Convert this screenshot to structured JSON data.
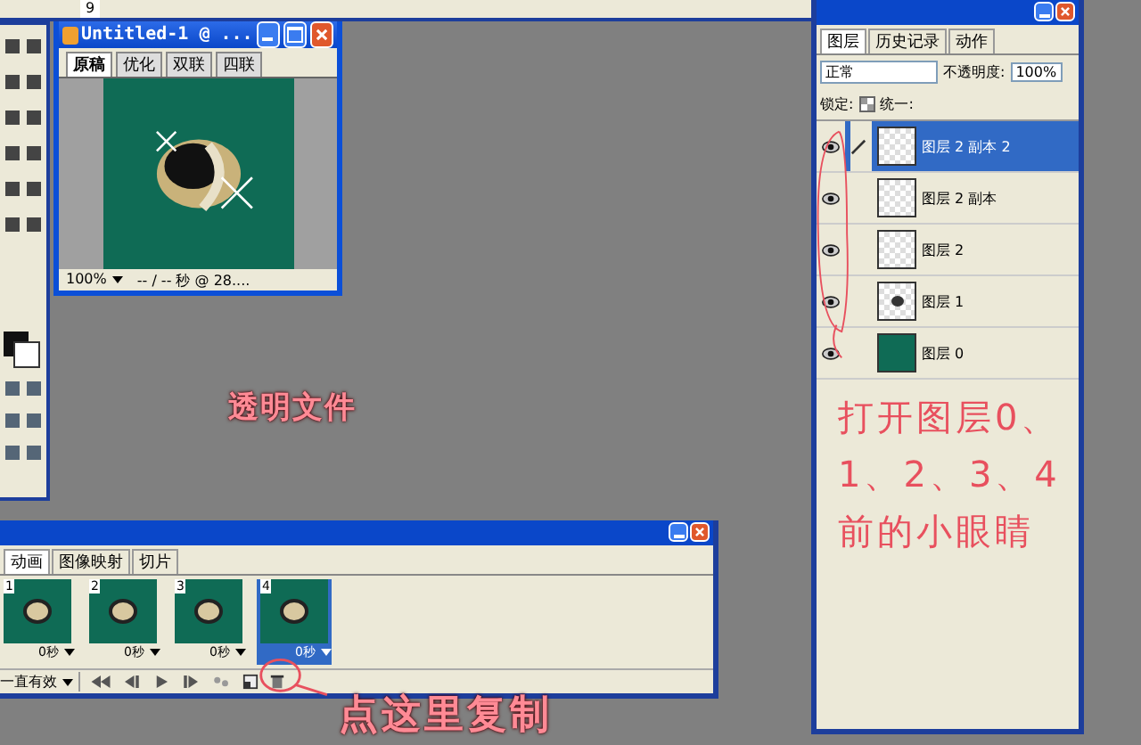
{
  "options_bar": {
    "value": "9"
  },
  "document_window": {
    "title": "Untitled-1 @ ...",
    "tabs": [
      {
        "label": "原稿",
        "selected": true
      },
      {
        "label": "优化",
        "selected": false
      },
      {
        "label": "双联",
        "selected": false
      },
      {
        "label": "四联",
        "selected": false
      }
    ],
    "zoom": "100%",
    "status": "-- / -- 秒 @ 28...."
  },
  "canvas_label": "透明文件",
  "layers_panel": {
    "tabs": [
      {
        "label": "图层",
        "selected": true
      },
      {
        "label": "历史记录",
        "selected": false
      },
      {
        "label": "动作",
        "selected": false
      }
    ],
    "blend_mode": "正常",
    "opacity_label": "不透明度:",
    "opacity": "100%",
    "lock_label": "锁定:",
    "unify_label": "统一:",
    "layers": [
      {
        "name": "图层 2 副本 2",
        "selected": true,
        "visible": true,
        "kind": "transparent"
      },
      {
        "name": "图层 2 副本",
        "selected": false,
        "visible": true,
        "kind": "transparent"
      },
      {
        "name": "图层 2",
        "selected": false,
        "visible": true,
        "kind": "transparent"
      },
      {
        "name": "图层 1",
        "selected": false,
        "visible": true,
        "kind": "object"
      },
      {
        "name": "图层 0",
        "selected": false,
        "visible": true,
        "kind": "fill"
      }
    ]
  },
  "animation_panel": {
    "tabs": [
      {
        "label": "动画",
        "selected": true
      },
      {
        "label": "图像映射",
        "selected": false
      },
      {
        "label": "切片",
        "selected": false
      }
    ],
    "frames": [
      {
        "number": "1",
        "delay": "0秒",
        "selected": false
      },
      {
        "number": "2",
        "delay": "0秒",
        "selected": false
      },
      {
        "number": "3",
        "delay": "0秒",
        "selected": false
      },
      {
        "number": "4",
        "delay": "0秒",
        "selected": true
      }
    ],
    "loop": "一直有效"
  },
  "annotations": {
    "eye_note": [
      "打开图层0、",
      "1、2、3、4",
      "前的小眼睛"
    ],
    "copy_note": "点这里复制"
  }
}
